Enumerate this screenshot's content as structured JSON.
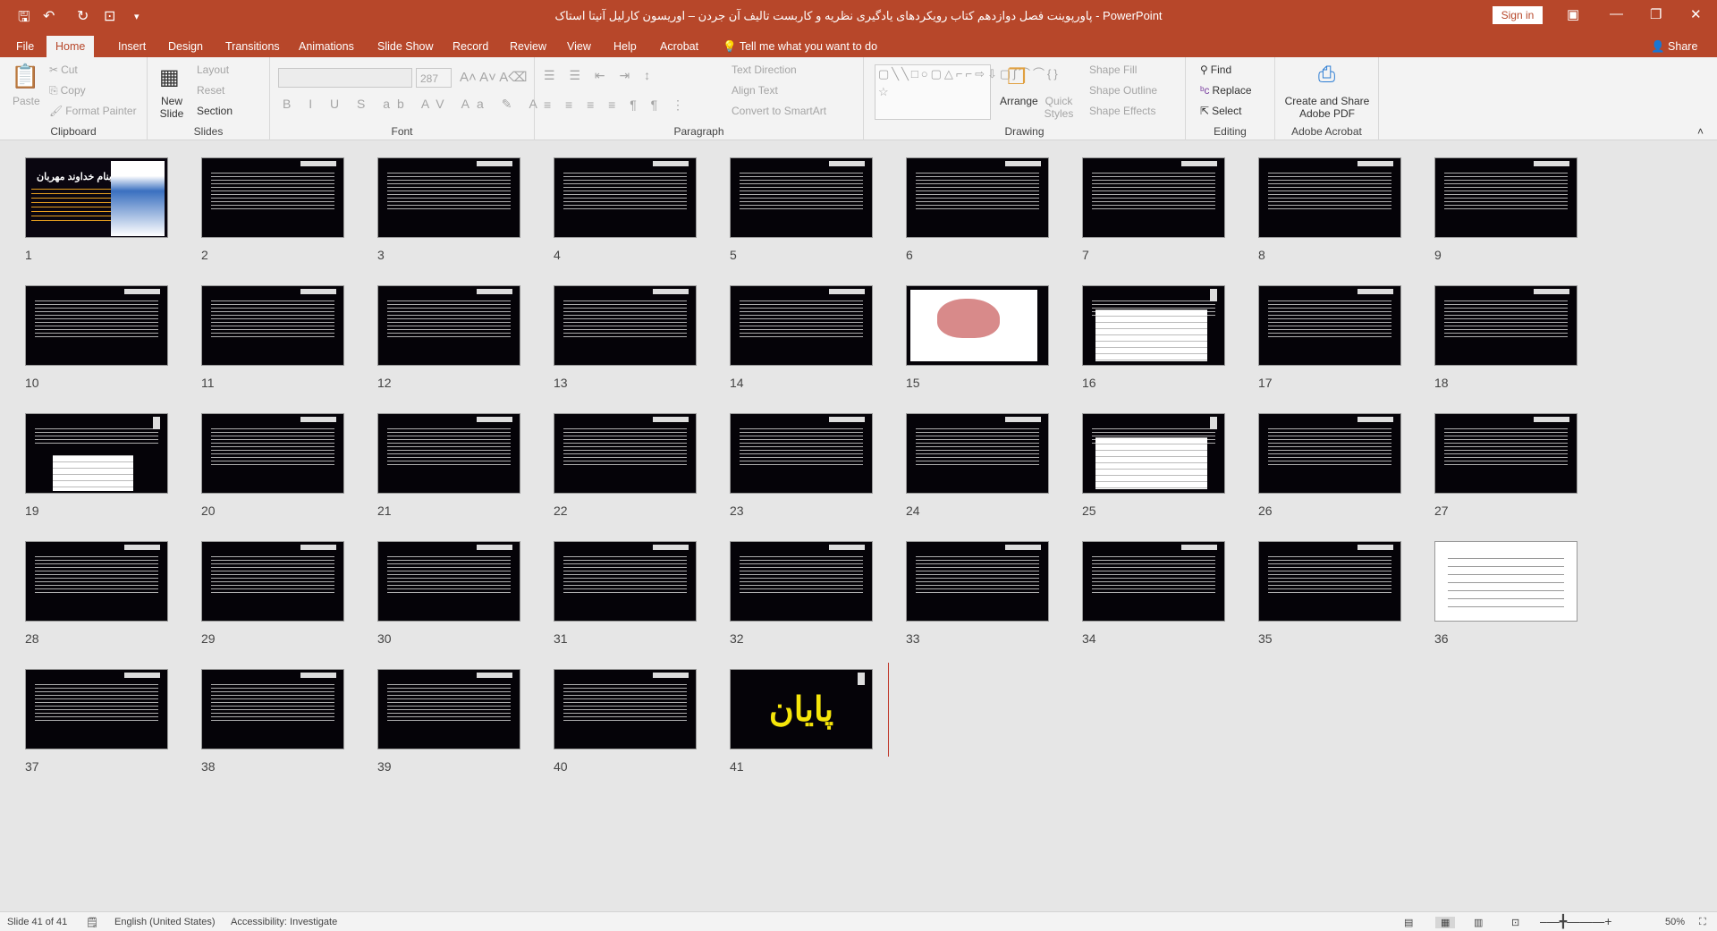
{
  "titlebar": {
    "title": "پاورپوینت فصل دوازدهم کتاب رویکردهای یادگیری نظریه و کاربست تالیف آن جردن – اوریسون کارلیل آنیتا استاک  -  PowerPoint",
    "sign_in": "Sign in",
    "qa_icons": [
      "save-icon",
      "undo-icon",
      "redo-icon",
      "start-from-beginning-icon",
      "customize-icon"
    ]
  },
  "tabs": [
    "File",
    "Home",
    "Insert",
    "Design",
    "Transitions",
    "Animations",
    "Slide Show",
    "Record",
    "Review",
    "View",
    "Help",
    "Acrobat"
  ],
  "tell_me": "Tell me what you want to do",
  "share": "Share",
  "ribbon": {
    "clipboard": {
      "label": "Clipboard",
      "paste": "Paste",
      "cut": "Cut",
      "copy": "Copy",
      "format_painter": "Format Painter"
    },
    "slides": {
      "label": "Slides",
      "new_slide": "New Slide",
      "layout": "Layout",
      "reset": "Reset",
      "section": "Section"
    },
    "font": {
      "label": "Font",
      "size": "287"
    },
    "paragraph": {
      "label": "Paragraph",
      "text_direction": "Text Direction",
      "align_text": "Align Text",
      "convert": "Convert to SmartArt"
    },
    "drawing": {
      "label": "Drawing",
      "arrange": "Arrange",
      "quick_styles": "Quick Styles",
      "shape_fill": "Shape Fill",
      "shape_outline": "Shape Outline",
      "shape_effects": "Shape Effects"
    },
    "editing": {
      "label": "Editing",
      "find": "Find",
      "replace": "Replace",
      "select": "Select"
    },
    "acrobat": {
      "label": "Adobe Acrobat",
      "create": "Create and Share Adobe PDF"
    }
  },
  "slides": {
    "slide1_title": "بنام خداوند مهربان",
    "slide41_title": "پایان",
    "special": {
      "15": "image",
      "16": "table",
      "19": "table",
      "25": "table",
      "36": "white"
    },
    "count": 41
  },
  "status": {
    "slide": "Slide 41 of 41",
    "language": "English (United States)",
    "accessibility": "Accessibility: Investigate",
    "zoom": "50%"
  },
  "colors": {
    "accent": "#b7472a",
    "end_text": "#f5e50a"
  }
}
